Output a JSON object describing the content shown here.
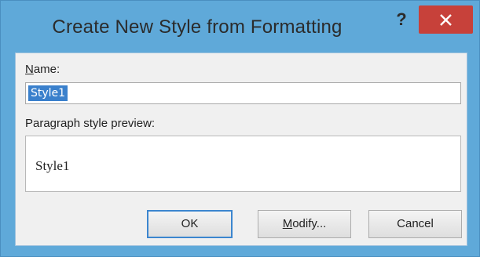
{
  "dialog": {
    "title": "Create New Style from Formatting",
    "help_label": "?",
    "close_label": "×"
  },
  "name": {
    "label_mnemonic": "N",
    "label_rest": "ame:",
    "value": "Style1"
  },
  "preview": {
    "label": "Paragraph style preview:",
    "text": "Style1"
  },
  "buttons": {
    "ok": "OK",
    "modify_mnemonic": "M",
    "modify_rest": "odify...",
    "cancel": "Cancel"
  },
  "colors": {
    "frame": "#5fa9d9",
    "close": "#c7413a",
    "selection": "#3a80cc"
  }
}
